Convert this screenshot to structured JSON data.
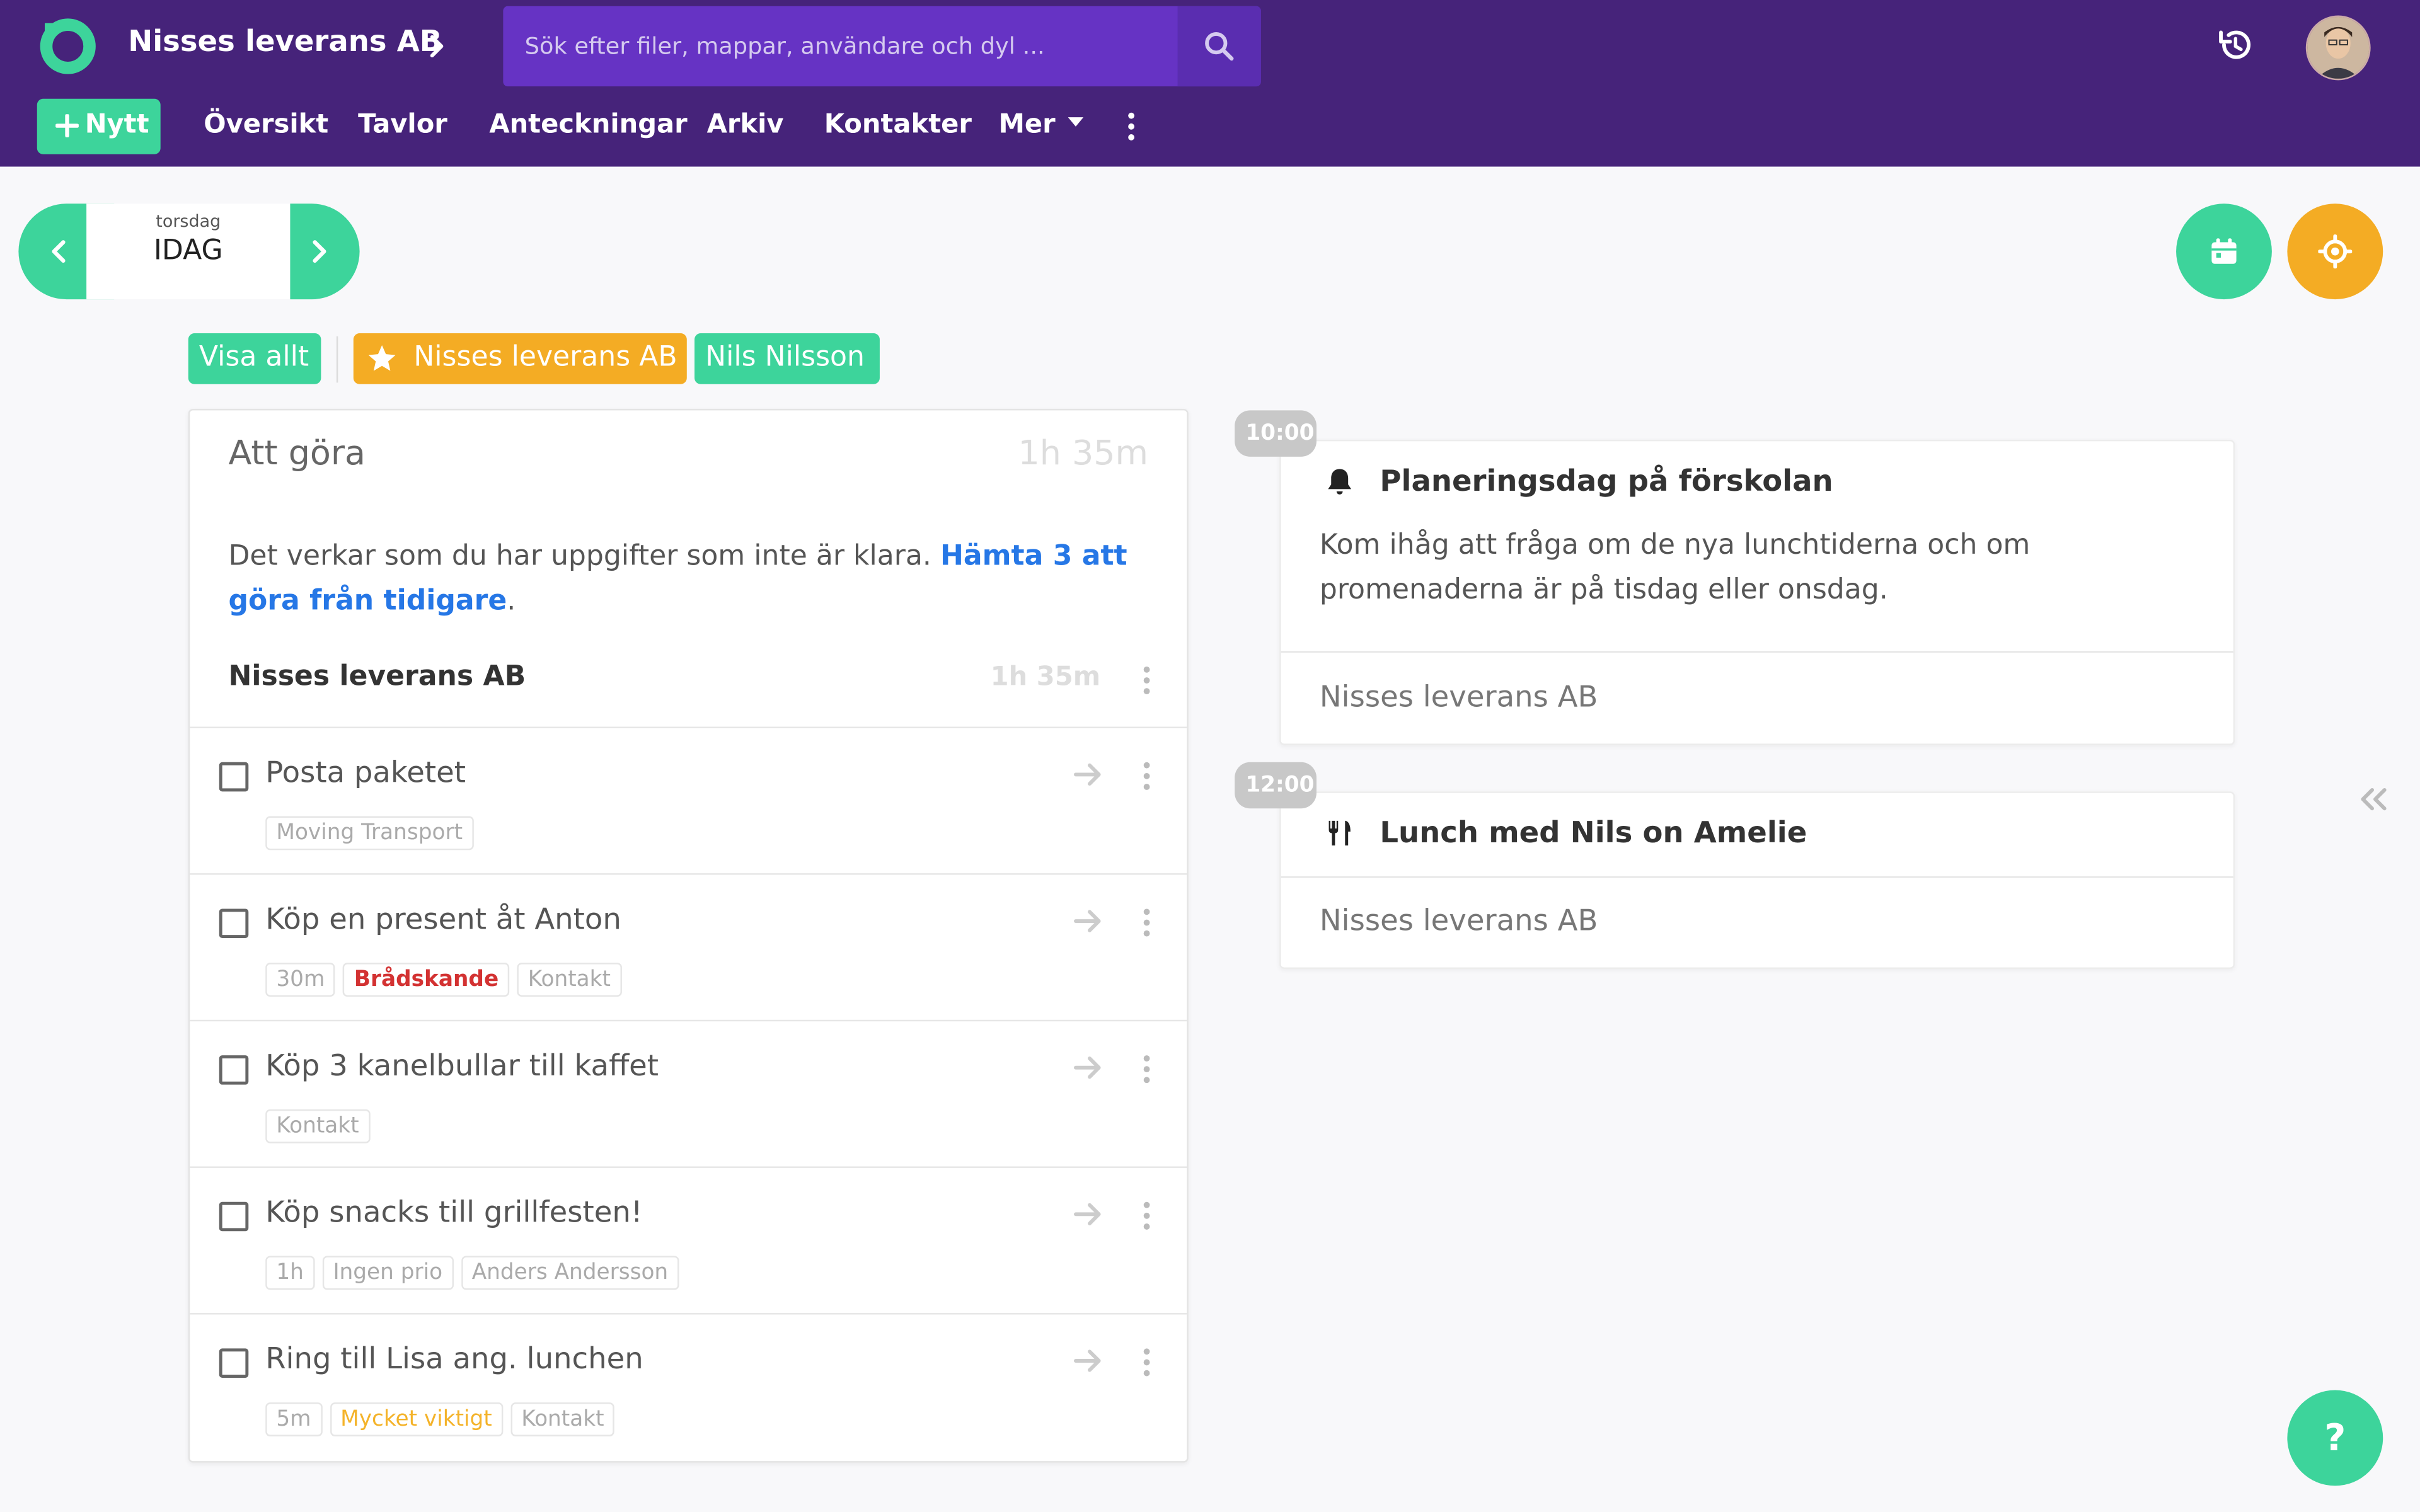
{
  "header": {
    "company": "Nisses leverans AB",
    "search_placeholder": "Sök efter filer, mappar, användare och dyl ...",
    "new_label": "Nytt",
    "nav": [
      "Översikt",
      "Tavlor",
      "Anteckningar",
      "Arkiv",
      "Kontakter",
      "Mer"
    ]
  },
  "date_nav": {
    "day": "torsdag",
    "label": "IDAG"
  },
  "filters": [
    "Visa allt",
    "Nisses leverans AB",
    "Nils Nilsson"
  ],
  "todo": {
    "title": "Att göra",
    "total": "1h 35m",
    "notice_text": "Det verkar som du har uppgifter som inte är klara. ",
    "notice_link": "Hämta 3 att göra från tidigare",
    "notice_end": ".",
    "group_title": "Nisses leverans AB",
    "group_time": "1h 35m",
    "tasks": [
      {
        "title": "Posta paketet",
        "tags": [
          "Moving Transport"
        ]
      },
      {
        "title": "Köp en present åt Anton",
        "tags": [
          "30m",
          "Brådskande",
          "Kontakt"
        ]
      },
      {
        "title": "Köp 3 kanelbullar till kaffet",
        "tags": [
          "Kontakt"
        ]
      },
      {
        "title": "Köp snacks till grillfesten!",
        "tags": [
          "1h",
          "Ingen prio",
          "Anders Andersson"
        ]
      },
      {
        "title": "Ring till Lisa ang. lunchen",
        "tags": [
          "5m",
          "Mycket viktigt",
          "Kontakt"
        ]
      }
    ]
  },
  "events": [
    {
      "time": "10:00",
      "icon": "bell-icon",
      "title": "Planeringsdag på förskolan",
      "description": "Kom ihåg att fråga om de nya lunchtiderna och om promenaderna är på tisdag eller onsdag.",
      "footer": "Nisses leverans AB"
    },
    {
      "time": "12:00",
      "icon": "utensils-icon",
      "title": "Lunch med Nils on Amelie",
      "footer": "Nisses leverans AB"
    }
  ],
  "help_label": "?",
  "colors": {
    "header": "#46237a",
    "search": "#6633c4",
    "green": "#3dd49b",
    "orange": "#f4ac24",
    "link": "#2677e6",
    "urgent": "#d33232",
    "important": "#f4b32a"
  }
}
